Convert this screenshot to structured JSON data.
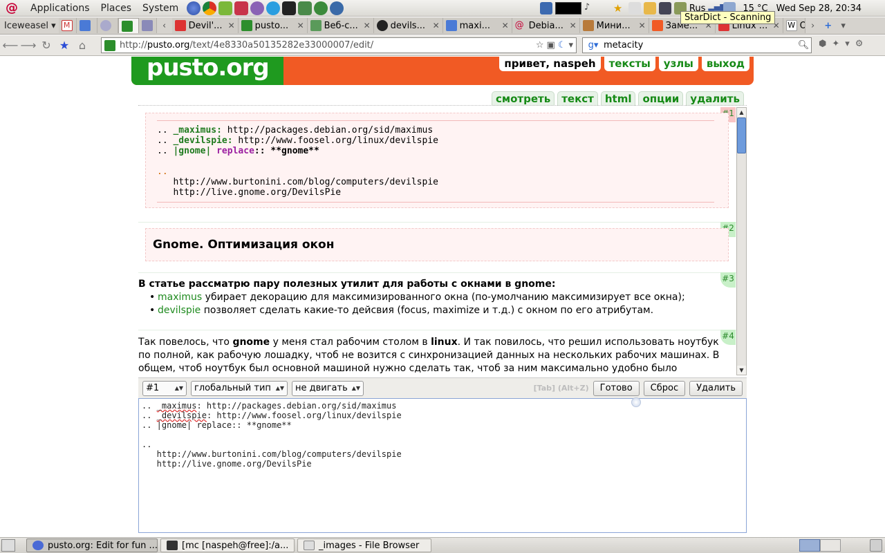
{
  "top_panel": {
    "menus": [
      "Applications",
      "Places",
      "System"
    ],
    "lang": "Rus",
    "weather": "15 °C",
    "clock": "Wed Sep 28, 20:34",
    "tooltip": "StarDict - Scanning"
  },
  "browser": {
    "name": "Iceweasel",
    "tabs": [
      {
        "label": "Devil'..."
      },
      {
        "label": "pusto..."
      },
      {
        "label": "Веб-с..."
      },
      {
        "label": "devils..."
      },
      {
        "label": "maxi..."
      },
      {
        "label": "Debia..."
      },
      {
        "label": "Мини..."
      },
      {
        "label": "Заме..."
      },
      {
        "label": "Linux ..."
      },
      {
        "label": "O"
      }
    ],
    "url_prefix": "http://",
    "url_host": "pusto.org",
    "url_path": "/text/4e8330a50135282e33000007/edit/",
    "search_value": "metacity"
  },
  "site": {
    "logo": "pusto.org",
    "greeting": "привет, naspeh",
    "nav": [
      "тексты",
      "узлы",
      "выход"
    ],
    "tabs": [
      "смотреть",
      "текст",
      "html",
      "опции",
      "удалить"
    ]
  },
  "content": {
    "block_labels": [
      "#1",
      "#2",
      "#3",
      "#4"
    ],
    "code": {
      "line1_prefix": ".. ",
      "line1_kw": "_maximus:",
      "line1_url": " http://packages.debian.org/sid/maximus",
      "line2_prefix": ".. ",
      "line2_kw": "_devilspie:",
      "line2_url": " http://www.foosel.org/linux/devilspie",
      "line3_prefix": ".. ",
      "line3_kw": "|gnome|",
      "line3_kw2": " replace",
      "line3_rest": ":: **gnome**",
      "line5": "..",
      "line6": "   http://www.burtonini.com/blog/computers/devilspie",
      "line7": "   http://live.gnome.org/DevilsPie"
    },
    "heading": "Gnome. Оптимизация окон",
    "intro": "В статье рассматрю пару полезных утилит для работы с окнами в gnome:",
    "bullets": [
      {
        "link": "maximus",
        "text": " убирает декорацию для максимизированного окна (по-умолчанию максимизирует все окна);"
      },
      {
        "link": "devilspie",
        "text": " позволяет сделать какие-то дейсвия (focus, maximize и т.д.) с окном по его атрибутам."
      }
    ],
    "para4_a": "Так повелось, что ",
    "para4_b": "gnome",
    "para4_c": " у меня стал рабочим столом в ",
    "para4_d": "linux",
    "para4_e": ". И так повилось, что решил использовать ноутбук по полной, как рабочую лошадку, чтоб не возится с синхронизацией данных на нескольких рабочих машинах. В общем, чтоб ноутбук был основной машиной нужно сделать так, чтоб за ним максимально удобно было работать."
  },
  "editor": {
    "block_select": "#1",
    "type_select": "глобальный тип",
    "move_select": "не двигать",
    "hotkey": "[Tab] (Alt+Z)",
    "done_button": "Готово",
    "reset_button": "Сброс",
    "delete_button": "Удалить",
    "lines": [
      ".. _maximus: http://packages.debian.org/sid/maximus",
      ".. _devilspie: http://www.foosel.org/linux/devilspie",
      ".. |gnome| replace:: **gnome**",
      "",
      "..",
      "   http://www.burtonini.com/blog/computers/devilspie",
      "   http://live.gnome.org/DevilsPie"
    ]
  },
  "taskbar": {
    "tasks": [
      {
        "label": "pusto.org: Edit for fun ..."
      },
      {
        "label": "[mc [naspeh@free]:/a..."
      },
      {
        "label": "_images - File Browser"
      }
    ]
  }
}
